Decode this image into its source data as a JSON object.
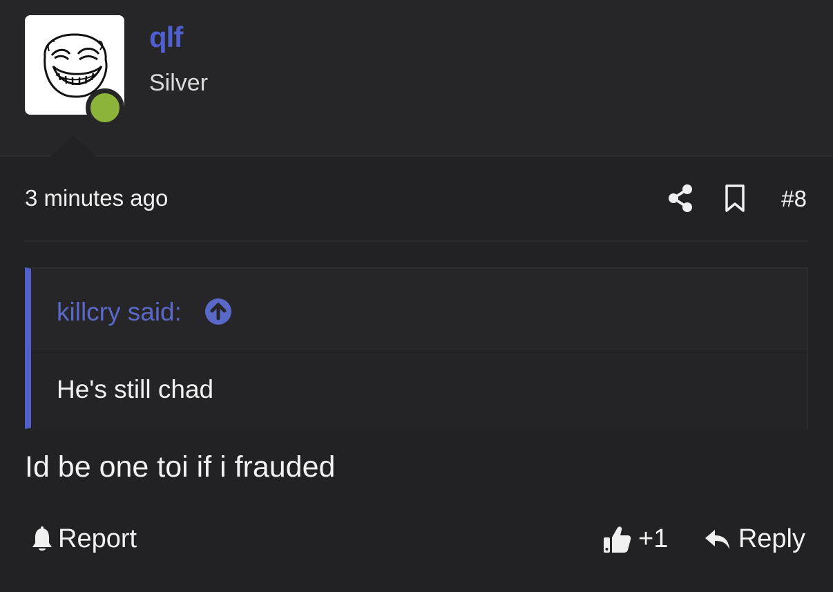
{
  "user": {
    "name": "qlf",
    "rank": "Silver",
    "status_color": "#8cb33a",
    "avatar_icon": "trollface-avatar"
  },
  "post": {
    "timestamp": "3 minutes ago",
    "number": "#8",
    "body": "Id be one toi if i frauded"
  },
  "quote": {
    "author_label": "killcry said:",
    "text": "He's still chad"
  },
  "actions": {
    "report_label": "Report",
    "like_count": "+1",
    "reply_label": "Reply"
  },
  "colors": {
    "accent": "#4f5fcf",
    "background": "#222224"
  }
}
